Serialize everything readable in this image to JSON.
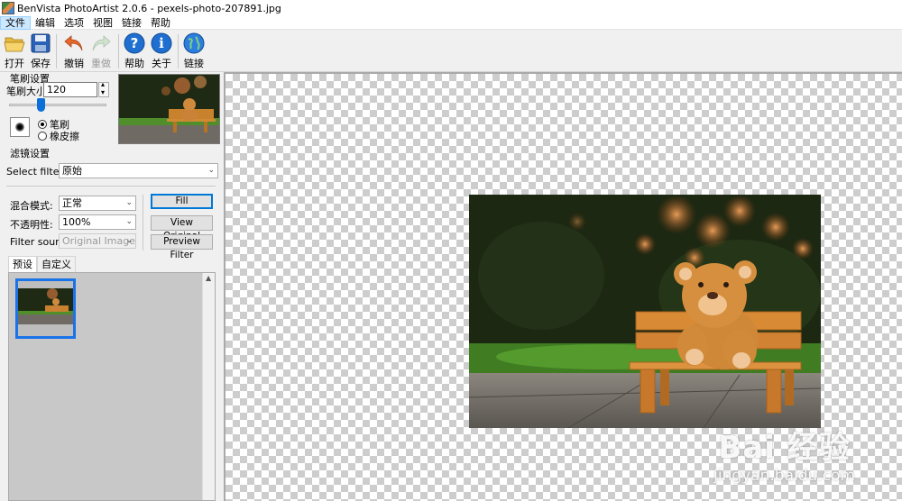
{
  "window": {
    "title": "BenVista PhotoArtist 2.0.6 - pexels-photo-207891.jpg"
  },
  "menu": [
    "文件",
    "编辑",
    "选项",
    "视图",
    "链接",
    "帮助"
  ],
  "toolbar": {
    "open": "打开",
    "save": "保存",
    "undo": "撤销",
    "redo": "重做",
    "help": "帮助",
    "about": "关于",
    "link": "链接"
  },
  "brush": {
    "group_label": "笔刷设置",
    "size_label": "笔刷大小:",
    "size_value": "120",
    "size_fraction": 0.3,
    "mode_brush": "笔刷",
    "mode_eraser": "橡皮擦",
    "selected_mode": "笔刷"
  },
  "filter": {
    "group_label": "滤镜设置",
    "select_label": "Select filter:",
    "select_value": "原始",
    "blend_label": "混合模式:",
    "blend_value": "正常",
    "opacity_label": "不透明性:",
    "opacity_value": "100%",
    "source_label": "Filter source:",
    "source_value": "Original Image",
    "fill_button": "Fill",
    "view_original_button": "View Original",
    "preview_filter_button": "Preview Filter"
  },
  "presets": {
    "tabs": [
      "预设",
      "自定义"
    ],
    "active_tab": "预设"
  },
  "watermark": {
    "main": "Bai 经验",
    "sub": "jingyan.baidu.com"
  },
  "colors": {
    "accent": "#0078d7",
    "selection": "#1a73e8",
    "checker": "#cdcdcd"
  }
}
